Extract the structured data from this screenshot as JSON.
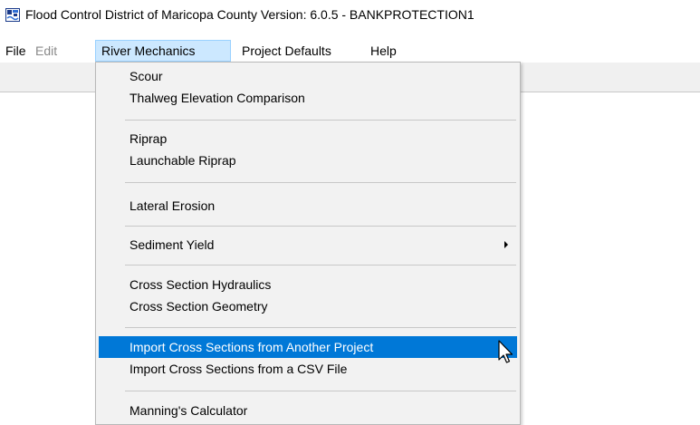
{
  "window": {
    "title": "Flood Control District of Maricopa County Version: 6.0.5 - BANKPROTECTION1",
    "icon": "app-logo-icon"
  },
  "menubar": {
    "items": [
      {
        "label": "File",
        "state": "normal"
      },
      {
        "label": "Edit",
        "state": "disabled"
      },
      {
        "label": "River Mechanics",
        "state": "active"
      },
      {
        "label": "Project Defaults",
        "state": "normal"
      },
      {
        "label": "Help",
        "state": "normal"
      }
    ]
  },
  "river_mechanics_menu": {
    "items": [
      {
        "label": "Scour",
        "mnemonic": "S"
      },
      {
        "label": "Thalweg Elevation Comparison",
        "mnemonic": "T"
      },
      {
        "label": "Riprap",
        "mnemonic": "R"
      },
      {
        "label": "Launchable Riprap",
        "mnemonic": "L"
      },
      {
        "label": "Lateral Erosion",
        "mnemonic": "t"
      },
      {
        "label": "Sediment Yield",
        "mnemonic": "S",
        "submenu": true
      },
      {
        "label": "Cross Section Hydraulics",
        "mnemonic": "C"
      },
      {
        "label": "Cross Section Geometry",
        "mnemonic": "G"
      },
      {
        "label": "Import Cross Sections from Another Project",
        "mnemonic": "P",
        "highlighted": true
      },
      {
        "label": "Import Cross Sections from a CSV File",
        "mnemonic": "C"
      },
      {
        "label": "Manning's Calculator",
        "mnemonic": "M"
      }
    ]
  },
  "colors": {
    "highlight": "#0078d7",
    "menu_active": "#cce8ff",
    "disabled_text": "#8a8a8a"
  }
}
